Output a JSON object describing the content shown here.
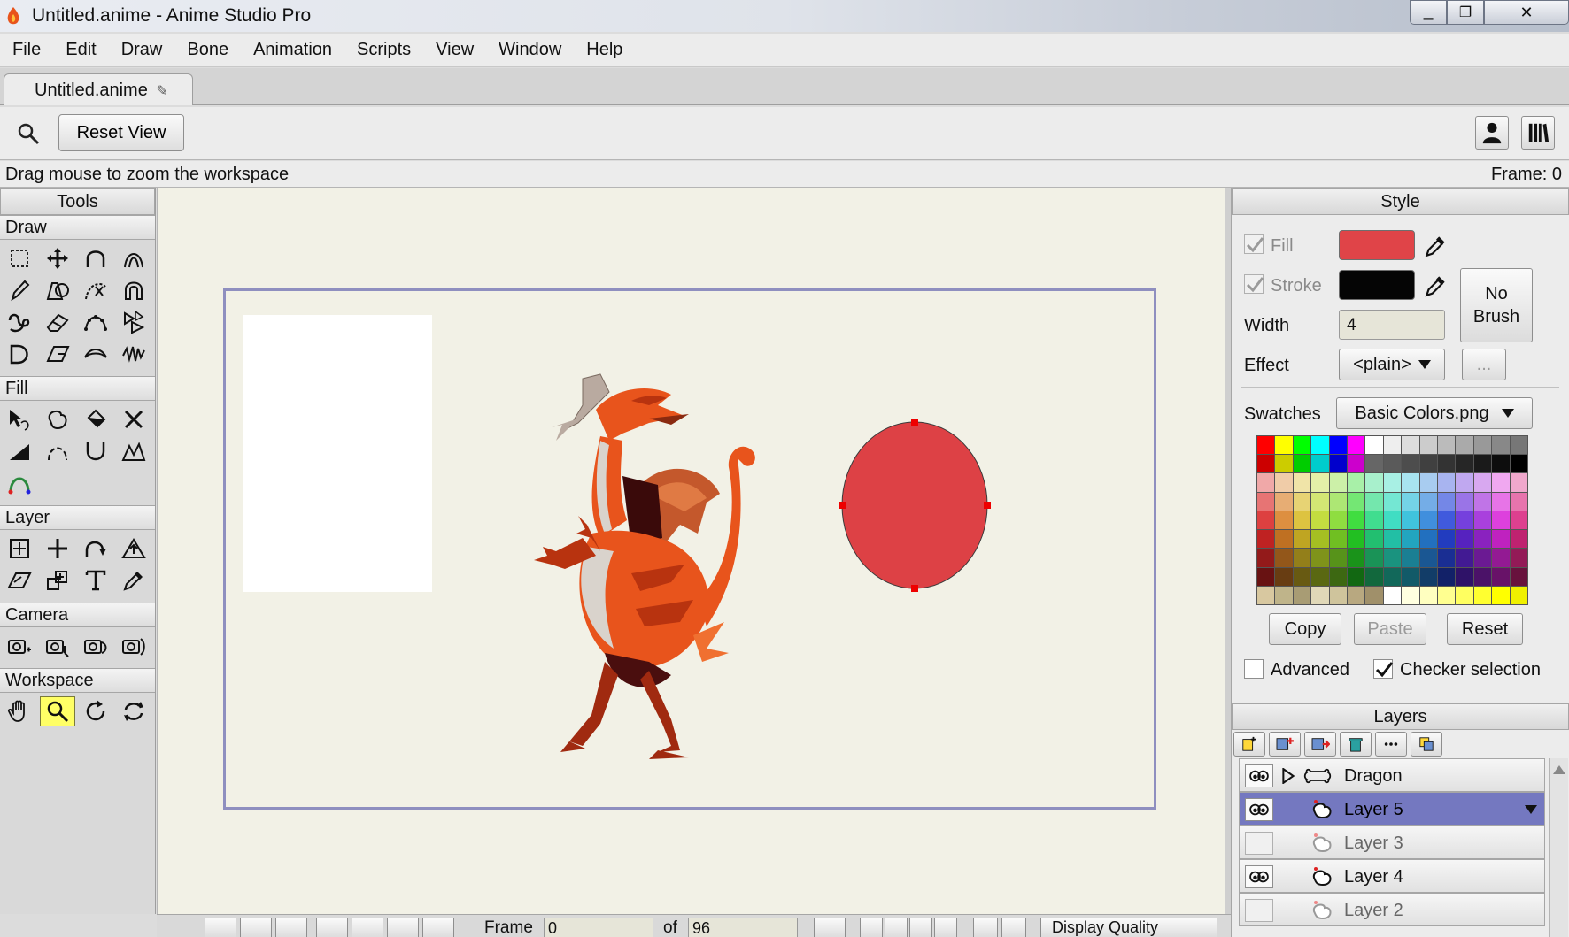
{
  "window": {
    "title": "Untitled.anime - Anime Studio Pro",
    "minimize_label": "▁",
    "maximize_label": "❐",
    "close_label": "✕"
  },
  "menu": [
    "File",
    "Edit",
    "Draw",
    "Bone",
    "Animation",
    "Scripts",
    "View",
    "Window",
    "Help"
  ],
  "document_tab": {
    "label": "Untitled.anime",
    "modified_glyph": "✎"
  },
  "toolbar": {
    "reset_view_label": "Reset View"
  },
  "status": {
    "hint": "Drag mouse to zoom the workspace",
    "frame_readout": "Frame: 0"
  },
  "tools": {
    "header": "Tools",
    "sections": {
      "draw": "Draw",
      "fill": "Fill",
      "layer": "Layer",
      "camera": "Camera",
      "workspace": "Workspace"
    },
    "active_tool": "zoom-tool"
  },
  "style": {
    "header": "Style",
    "fill_label": "Fill",
    "fill_color": "#e04448",
    "stroke_label": "Stroke",
    "stroke_color": "#050505",
    "width_label": "Width",
    "width_value": "4",
    "brush_label_line1": "No",
    "brush_label_line2": "Brush",
    "effect_label": "Effect",
    "effect_value": "<plain>",
    "effect_more": "...",
    "swatches_label": "Swatches",
    "swatches_value": "Basic Colors.png",
    "copy_label": "Copy",
    "paste_label": "Paste",
    "reset_label": "Reset",
    "advanced_label": "Advanced",
    "checker_label": "Checker selection",
    "advanced_checked": false,
    "checker_checked": true
  },
  "layers": {
    "header": "Layers",
    "items": [
      {
        "name": "Dragon",
        "type": "bone",
        "visible": true,
        "selected": false,
        "dim": false
      },
      {
        "name": "Layer 5",
        "type": "vector",
        "visible": true,
        "selected": true,
        "dim": false
      },
      {
        "name": "Layer 3",
        "type": "vector",
        "visible": false,
        "selected": false,
        "dim": true
      },
      {
        "name": "Layer 4",
        "type": "vector",
        "visible": true,
        "selected": false,
        "dim": false
      },
      {
        "name": "Layer 2",
        "type": "vector",
        "visible": false,
        "selected": false,
        "dim": true
      }
    ]
  },
  "timeline": {
    "frame_label": "Frame",
    "frame_value": "0",
    "of_label": "of",
    "total_frames": "96",
    "display_quality_label": "Display Quality"
  },
  "canvas": {
    "background_color": "#f2f1e6",
    "frame_border_color": "#8f8fbf",
    "ellipse_color": "#dd4145"
  }
}
